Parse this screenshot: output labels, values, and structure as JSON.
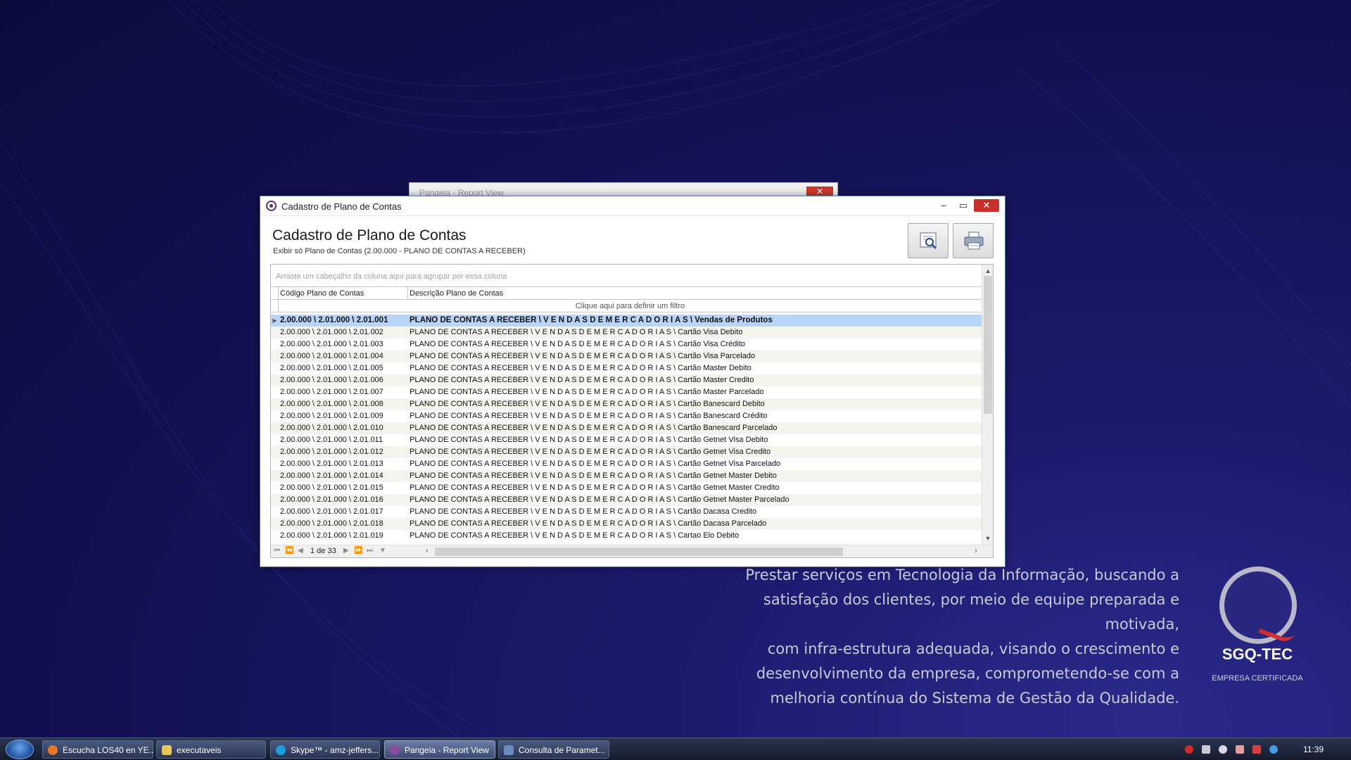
{
  "ghost_window": {
    "title": "Pangeia - Report View",
    "close": "✕"
  },
  "window": {
    "title": "Cadastro de Plano de Contas",
    "controls": {
      "minimize": "–",
      "maximize": "▭",
      "close": "✕"
    }
  },
  "header": {
    "title": "Cadastro de Plano de Contas",
    "subtitle": "Exibir só Plano de Contas (2.00.000 - PLANO DE CONTAS A RECEBER)"
  },
  "grid": {
    "group_hint": "Arraste um cabeçalho da coluna aqui para agrupar por essa coluna",
    "columns": [
      "Código Plano de Contas",
      "Descrição Plano de Contas"
    ],
    "filter_hint": "Clique aqui para definir um filtro",
    "rows": [
      {
        "code": "2.00.000 \\ 2.01.000 \\ 2.01.001",
        "desc": "PLANO DE CONTAS A RECEBER \\ V E N D A S  D E  M E R C A D O R I A S \\ Vendas de Produtos"
      },
      {
        "code": "2.00.000 \\ 2.01.000 \\ 2.01.002",
        "desc": "PLANO DE CONTAS A RECEBER \\ V E N D A S  D E  M E R C A D O R I A S \\ Cartão Visa Debito"
      },
      {
        "code": "2.00.000 \\ 2.01.000 \\ 2.01.003",
        "desc": "PLANO DE CONTAS A RECEBER \\ V E N D A S  D E  M E R C A D O R I A S \\ Cartão Visa Crédito"
      },
      {
        "code": "2.00.000 \\ 2.01.000 \\ 2.01.004",
        "desc": "PLANO DE CONTAS A RECEBER \\ V E N D A S  D E  M E R C A D O R I A S \\ Cartão Visa Parcelado"
      },
      {
        "code": "2.00.000 \\ 2.01.000 \\ 2.01.005",
        "desc": "PLANO DE CONTAS A RECEBER \\ V E N D A S  D E  M E R C A D O R I A S \\ Cartão Master Debito"
      },
      {
        "code": "2.00.000 \\ 2.01.000 \\ 2.01.006",
        "desc": "PLANO DE CONTAS A RECEBER \\ V E N D A S  D E  M E R C A D O R I A S \\ Cartão Master Credito"
      },
      {
        "code": "2.00.000 \\ 2.01.000 \\ 2.01.007",
        "desc": "PLANO DE CONTAS A RECEBER \\ V E N D A S  D E  M E R C A D O R I A S \\ Cartão Master Parcelado"
      },
      {
        "code": "2.00.000 \\ 2.01.000 \\ 2.01.008",
        "desc": "PLANO DE CONTAS A RECEBER \\ V E N D A S  D E  M E R C A D O R I A S \\ Cartão Banescard Debito"
      },
      {
        "code": "2.00.000 \\ 2.01.000 \\ 2.01.009",
        "desc": "PLANO DE CONTAS A RECEBER \\ V E N D A S  D E  M E R C A D O R I A S \\ Cartão Banescard Crédito"
      },
      {
        "code": "2.00.000 \\ 2.01.000 \\ 2.01.010",
        "desc": "PLANO DE CONTAS A RECEBER \\ V E N D A S  D E  M E R C A D O R I A S \\ Cartão Banescard Parcelado"
      },
      {
        "code": "2.00.000 \\ 2.01.000 \\ 2.01.011",
        "desc": "PLANO DE CONTAS A RECEBER \\ V E N D A S  D E  M E R C A D O R I A S \\ Cartão Getnet Visa Debito"
      },
      {
        "code": "2.00.000 \\ 2.01.000 \\ 2.01.012",
        "desc": "PLANO DE CONTAS A RECEBER \\ V E N D A S  D E  M E R C A D O R I A S \\ Cartão Getnet Visa Credito"
      },
      {
        "code": "2.00.000 \\ 2.01.000 \\ 2.01.013",
        "desc": "PLANO DE CONTAS A RECEBER \\ V E N D A S  D E  M E R C A D O R I A S \\ Cartão Getnet Visa Parcelado"
      },
      {
        "code": "2.00.000 \\ 2.01.000 \\ 2.01.014",
        "desc": "PLANO DE CONTAS A RECEBER \\ V E N D A S  D E  M E R C A D O R I A S \\ Cartão Getnet Master Debito"
      },
      {
        "code": "2.00.000 \\ 2.01.000 \\ 2.01.015",
        "desc": "PLANO DE CONTAS A RECEBER \\ V E N D A S  D E  M E R C A D O R I A S \\ Cartão Getnet Master Credito"
      },
      {
        "code": "2.00.000 \\ 2.01.000 \\ 2.01.016",
        "desc": "PLANO DE CONTAS A RECEBER \\ V E N D A S  D E  M E R C A D O R I A S \\ Cartão Getnet Master Parcelado"
      },
      {
        "code": "2.00.000 \\ 2.01.000 \\ 2.01.017",
        "desc": "PLANO DE CONTAS A RECEBER \\ V E N D A S  D E  M E R C A D O R I A S \\ Cartão Dacasa Credito"
      },
      {
        "code": "2.00.000 \\ 2.01.000 \\ 2.01.018",
        "desc": "PLANO DE CONTAS A RECEBER \\ V E N D A S  D E  M E R C A D O R I A S \\ Cartão Dacasa Parcelado"
      },
      {
        "code": "2.00.000 \\ 2.01.000 \\ 2.01.019",
        "desc": "PLANO DE CONTAS A RECEBER \\ V E N D A S  D E  M E R C A D O R I A S \\ Cartao Elo Debito"
      }
    ],
    "pager": "1 de 33"
  },
  "desktop": {
    "mission_lines": [
      "Prestar serviços em Tecnologia da Informação, buscando a",
      "satisfação dos clientes, por meio de equipe preparada e motivada,",
      "com infra-estrutura adequada, visando o crescimento e",
      "desenvolvimento da empresa, comprometendo-se com a",
      "melhoria contínua do Sistema de Gestão da Qualidade."
    ],
    "logo": "SGQ-TEC",
    "certified": "EMPRESA CERTIFICADA"
  },
  "taskbar": {
    "items": [
      {
        "label": "Escucha LOS40 en YE...",
        "icon": "firefox-icon",
        "color": "#e8742a"
      },
      {
        "label": "executaveis",
        "icon": "folder-icon",
        "color": "#e8c85a"
      },
      {
        "label": "Skype™ - amz-jeffers...",
        "icon": "skype-icon",
        "color": "#1aa0e0"
      },
      {
        "label": "Pangeia - Report View",
        "icon": "pangeia-icon",
        "color": "#8a4aa0"
      },
      {
        "label": "Consulta de Paramet...",
        "icon": "consulta-icon",
        "color": "#6a8ac0"
      }
    ],
    "clock": "11:39"
  }
}
